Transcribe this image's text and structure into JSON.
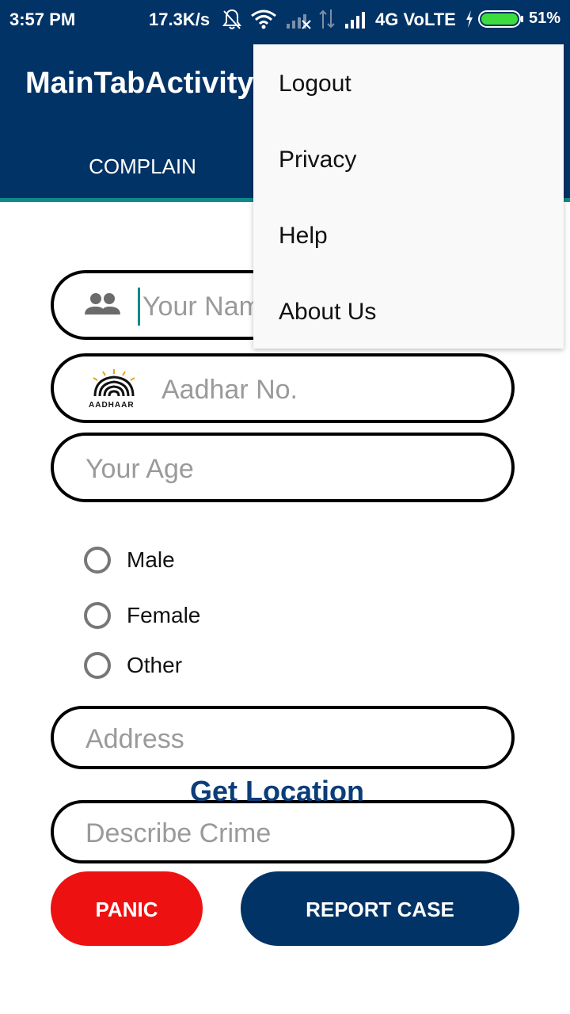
{
  "status_bar": {
    "time": "3:57 PM",
    "speed": "17.3K/s",
    "network": "4G VoLTE",
    "battery": "51%",
    "icons": [
      "mute-bell-icon",
      "wifi-icon",
      "signal-weak-icon",
      "data-arrows-icon",
      "signal-strong-icon",
      "charging-icon",
      "battery-icon"
    ]
  },
  "app_bar": {
    "title": "MainTabActivity",
    "tab_complain": "COMPLAIN"
  },
  "form": {
    "name_placeholder": "Your Name",
    "aadhar_placeholder": "Aadhar No.",
    "aadhaar_logo_text": "AADHAAR",
    "age_placeholder": "Your Age",
    "gender_options": [
      "Male",
      "Female",
      "Other"
    ],
    "address_placeholder": "Address",
    "get_location": "Get Location",
    "crime_placeholder": "Describe Crime"
  },
  "buttons": {
    "panic": "PANIC",
    "report_case": "REPORT CASE"
  },
  "menu": {
    "items": [
      "Logout",
      "Privacy",
      "Help",
      "About Us"
    ]
  },
  "colors": {
    "primary": "#023366",
    "accent": "#0f8a8a",
    "panic": "#ee1111"
  }
}
